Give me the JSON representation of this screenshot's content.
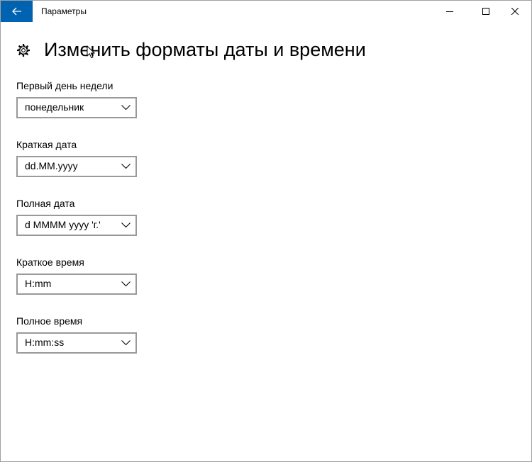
{
  "window": {
    "title": "Параметры"
  },
  "icons": {
    "back": "back-arrow-icon",
    "settings": "gear-icon",
    "minimize": "minimize-icon",
    "maximize": "maximize-icon",
    "close": "close-icon",
    "dropdown": "chevron-down-icon"
  },
  "colors": {
    "accent": "#0063b1",
    "border": "#999999",
    "background": "#ffffff"
  },
  "page": {
    "title": "Изменить форматы даты и времени"
  },
  "fields": [
    {
      "label": "Первый день недели",
      "value": "понедельник"
    },
    {
      "label": "Краткая дата",
      "value": "dd.MM.yyyy"
    },
    {
      "label": "Полная дата",
      "value": "d MMMM yyyy 'г.'"
    },
    {
      "label": "Краткое время",
      "value": "H:mm"
    },
    {
      "label": "Полное время",
      "value": "H:mm:ss"
    }
  ]
}
